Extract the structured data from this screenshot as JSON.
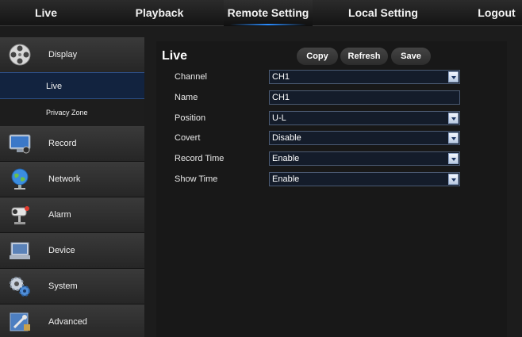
{
  "topnav": [
    {
      "label": "Live",
      "active": false
    },
    {
      "label": "Playback",
      "active": false
    },
    {
      "label": "Remote Setting",
      "active": true
    },
    {
      "label": "Local Setting",
      "active": false
    },
    {
      "label": "Logout",
      "active": false
    }
  ],
  "sidebar": {
    "display": {
      "label": "Display",
      "icon": "film-reel-icon"
    },
    "subitems": [
      {
        "label": "Live",
        "active": true
      },
      {
        "label": "Privacy Zone",
        "active": false
      }
    ],
    "record": {
      "label": "Record",
      "icon": "monitor-icon"
    },
    "network": {
      "label": "Network",
      "icon": "globe-icon"
    },
    "alarm": {
      "label": "Alarm",
      "icon": "camera-alarm-icon"
    },
    "device": {
      "label": "Device",
      "icon": "hard-drive-icon"
    },
    "system": {
      "label": "System",
      "icon": "gears-icon"
    },
    "advanced": {
      "label": "Advanced",
      "icon": "advanced-tools-icon"
    }
  },
  "main": {
    "title": "Live",
    "buttons": {
      "copy": "Copy",
      "refresh": "Refresh",
      "save": "Save"
    },
    "form": {
      "channel": {
        "label": "Channel",
        "value": "CH1"
      },
      "name": {
        "label": "Name",
        "value": "CH1"
      },
      "position": {
        "label": "Position",
        "value": "U-L"
      },
      "covert": {
        "label": "Covert",
        "value": "Disable"
      },
      "record_time": {
        "label": "Record Time",
        "value": "Enable"
      },
      "show_time": {
        "label": "Show Time",
        "value": "Enable"
      }
    }
  },
  "colors": {
    "accent": "#2a8cff",
    "active_sub": "#12233f",
    "field_bg": "#141c2a"
  }
}
